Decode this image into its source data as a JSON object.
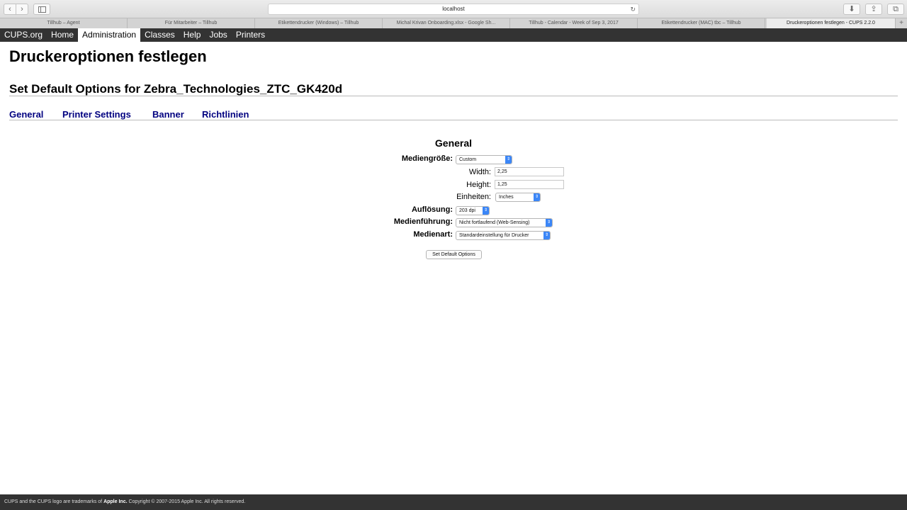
{
  "browser": {
    "url": "localhost",
    "tabs": [
      "Tillhub – Agent",
      "Für Mitarbeiter – Tillhub",
      "Etikettendrucker (Windows) – Tillhub",
      "Michal Krivan Onboarding.xlsx - Google Sh...",
      "Tillhub - Calendar - Week of Sep 3, 2017",
      "Etikettendrucker (MAC) tbc – Tillhub",
      "Druckeroptionen festlegen - CUPS 2.2.0"
    ],
    "active_tab_index": 6
  },
  "nav": {
    "items": [
      "CUPS.org",
      "Home",
      "Administration",
      "Classes",
      "Help",
      "Jobs",
      "Printers"
    ],
    "active": "Administration"
  },
  "page": {
    "title": "Druckeroptionen festlegen",
    "subtitle": "Set Default Options for Zebra_Technologies_ZTC_GK420d",
    "sections": [
      "General",
      "Printer Settings",
      "Banner",
      "Richtlinien"
    ]
  },
  "form": {
    "heading": "General",
    "mediengroesse_label": "Mediengröße:",
    "mediengroesse_value": "Custom",
    "width_label": "Width:",
    "width_value": "2,25",
    "height_label": "Height:",
    "height_value": "1,25",
    "einheiten_label": "Einheiten:",
    "einheiten_value": "Inches",
    "aufloesung_label": "Auflösung:",
    "aufloesung_value": "203 dpi",
    "medienfuehrung_label": "Medienführung:",
    "medienfuehrung_value": "Nicht fortlaufend (Web-Sensing)",
    "medienart_label": "Medienart:",
    "medienart_value": "Standardeinstellung für Drucker",
    "submit_label": "Set Default Options"
  },
  "footer": {
    "prefix": "CUPS and the CUPS logo are trademarks of ",
    "company": "Apple Inc.",
    "suffix": " Copyright © 2007-2015 Apple Inc. All rights reserved."
  }
}
